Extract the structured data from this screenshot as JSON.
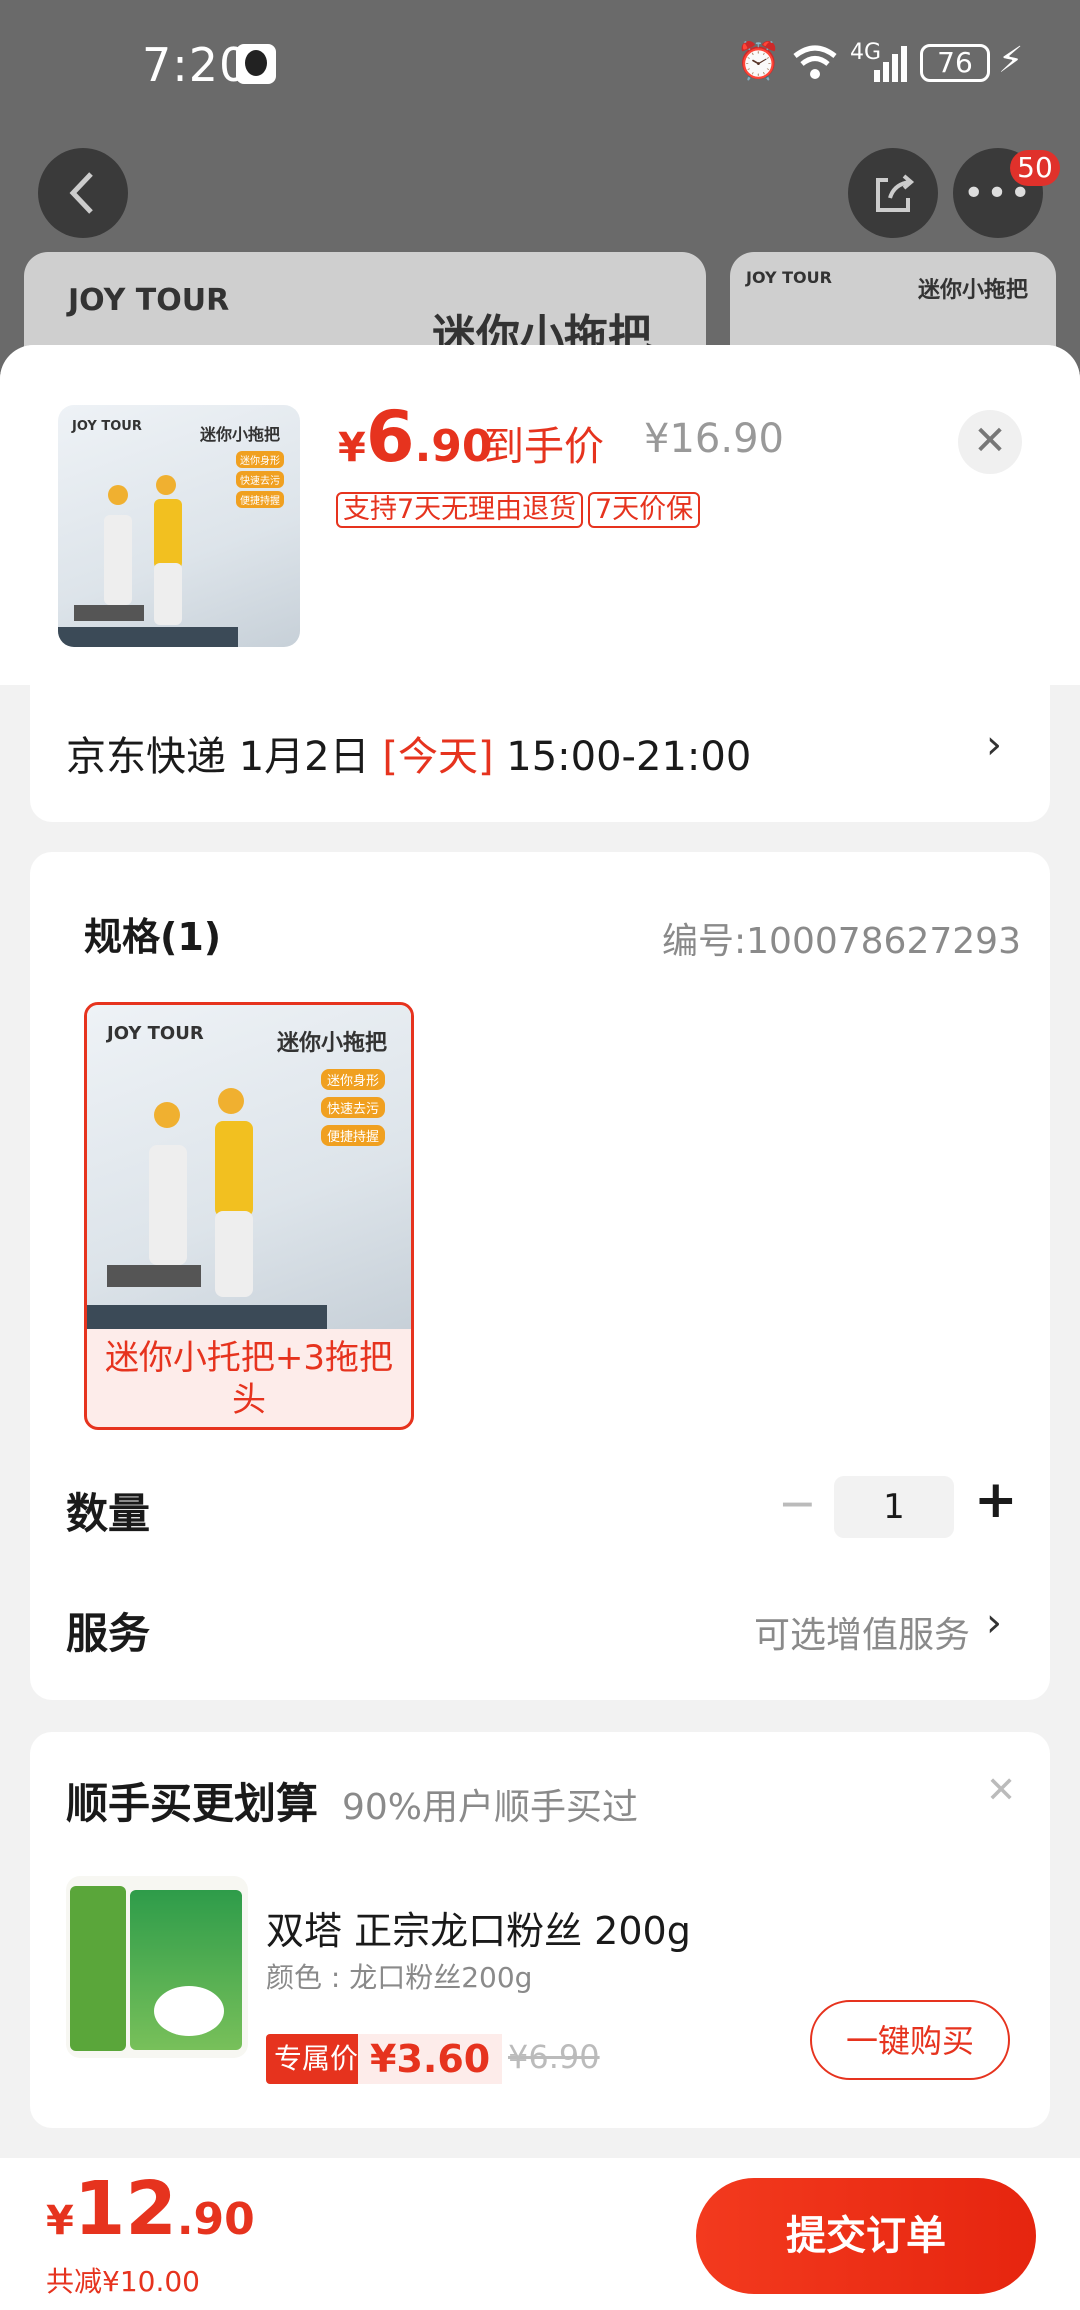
{
  "status_bar": {
    "time": "7:20",
    "battery": "76",
    "network": "4G"
  },
  "nav": {
    "badge_count": "50"
  },
  "background_product": {
    "brand": "JOY TOUR",
    "title": "迷你小拖把"
  },
  "product": {
    "thumb_brand": "JOY TOUR",
    "thumb_title": "迷你小拖把",
    "thumb_tags": [
      "迷你身形",
      "快速去污",
      "便捷持握"
    ],
    "price_symbol": "¥",
    "price_int": "6",
    "price_dec": ".90",
    "price_label": "到手价",
    "original_price": "¥16.90",
    "tags": [
      "支持7天无理由退货",
      "7天价保"
    ]
  },
  "delivery": {
    "carrier": "京东快递",
    "date": "1月2日",
    "today": "[今天]",
    "time_window": "15:00-21:00"
  },
  "spec": {
    "title": "规格(1)",
    "sku_number": "编号:100078627293",
    "option_label": "迷你小托把+3拖把头"
  },
  "quantity": {
    "label": "数量",
    "value": "1"
  },
  "service": {
    "label": "服务",
    "value": "可选增值服务"
  },
  "addon": {
    "title": "顺手买更划算",
    "subtitle": "90%用户顺手买过",
    "item_name": "双塔 正宗龙口粉丝 200g",
    "item_variant": "颜色 : 龙口粉丝200g",
    "exclusive_label": "专属价",
    "price": "¥3.60",
    "original_price": "¥6.90",
    "buy_button": "一键购买"
  },
  "footer": {
    "total_symbol": "¥",
    "total_int": "12",
    "total_dec": ".90",
    "discount": "共减¥10.00",
    "submit_label": "提交订单"
  },
  "colors": {
    "accent": "#e6331e",
    "submit": "#f33a1e"
  }
}
